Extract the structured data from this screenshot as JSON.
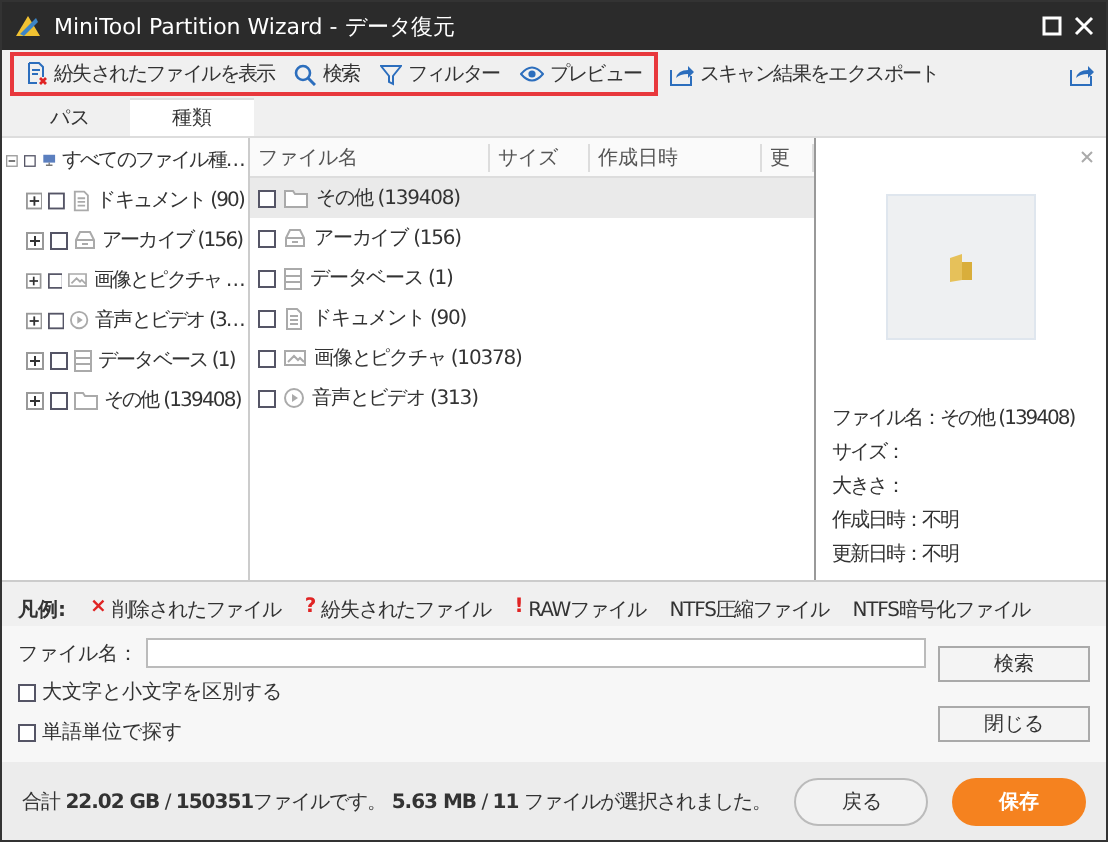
{
  "window": {
    "title": "MiniTool Partition Wizard - データ復元"
  },
  "toolbar": {
    "highlighted_group": [
      {
        "label": "紛失されたファイルを表示",
        "kind": "lost"
      },
      {
        "label": "検索",
        "kind": "search"
      },
      {
        "label": "フィルター",
        "kind": "filter"
      },
      {
        "label": "プレビュー",
        "kind": "eye"
      }
    ],
    "items": [
      {
        "label": "スキャン結果をエクスポート",
        "kind": "export"
      }
    ]
  },
  "tabs": [
    {
      "label": "パス",
      "selected": false
    },
    {
      "label": "種類",
      "selected": true
    }
  ],
  "tree": {
    "label": "すべてのファイル種…",
    "checked": false,
    "expanded": true,
    "children": [
      {
        "label": "ドキュメント (90)",
        "kind": "document",
        "checked": false,
        "expanded": false
      },
      {
        "label": "アーカイブ (156)",
        "kind": "archive",
        "checked": false,
        "expanded": false
      },
      {
        "label": "画像とピクチャ …",
        "kind": "image",
        "checked": false,
        "expanded": false
      },
      {
        "label": "音声とビデオ (3…",
        "kind": "media",
        "checked": false,
        "expanded": false
      },
      {
        "label": "データベース (1)",
        "kind": "database",
        "checked": false,
        "expanded": false
      },
      {
        "label": "その他 (139408)",
        "kind": "folder",
        "checked": false,
        "expanded": false
      }
    ]
  },
  "table": {
    "columns": [
      "ファイル名",
      "サイズ",
      "作成日時",
      "更"
    ],
    "rows": [
      {
        "name": "その他 (139408)",
        "kind": "folder",
        "checked": false,
        "selected": true
      },
      {
        "name": "アーカイブ (156)",
        "kind": "archive",
        "checked": false,
        "selected": false
      },
      {
        "name": "データベース (1)",
        "kind": "database",
        "checked": false,
        "selected": false
      },
      {
        "name": "ドキュメント (90)",
        "kind": "document",
        "checked": false,
        "selected": false
      },
      {
        "name": "画像とピクチャ (10378)",
        "kind": "image",
        "checked": false,
        "selected": false
      },
      {
        "name": "音声とビデオ (313)",
        "kind": "media",
        "checked": false,
        "selected": false
      }
    ]
  },
  "preview": {
    "info": [
      {
        "label": "ファイル名：",
        "value": "その他 (139408)"
      },
      {
        "label": "サイズ："
      },
      {
        "label": "大きさ："
      },
      {
        "label": "作成日時：",
        "value": "不明"
      },
      {
        "label": "更新日時：",
        "value": "不明"
      }
    ]
  },
  "legend": {
    "label": "凡例:",
    "items": [
      {
        "mark": "×",
        "color": "#e02424",
        "label": "削除されたファイル"
      },
      {
        "mark": "?",
        "color": "#e02424",
        "label": "紛失されたファイル"
      },
      {
        "mark": "!",
        "color": "#e02424",
        "label": "RAWファイル"
      },
      {
        "label": "NTFS圧縮ファイル"
      },
      {
        "label": "NTFS暗号化ファイル"
      }
    ]
  },
  "search": {
    "label": "ファイル名：",
    "options": [
      {
        "label": "大文字と小文字を区別する",
        "checked": false
      },
      {
        "label": "単語単位で探す",
        "checked": false
      }
    ],
    "buttons": [
      "検索",
      "閉じる"
    ]
  },
  "footer": {
    "summary": "合計 **22.02 GB** / **150351**ファイルです。 **5.63 MB** / **11** ファイルが選択されました。",
    "back": "戻る",
    "save": "保存"
  }
}
